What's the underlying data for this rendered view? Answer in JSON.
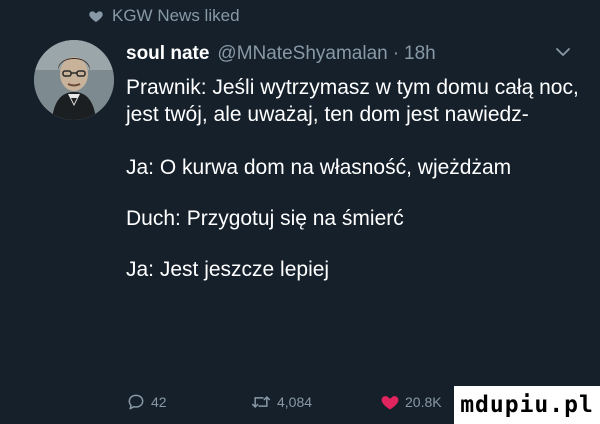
{
  "context": {
    "text": "KGW News liked",
    "icon": "heart-icon"
  },
  "author": {
    "display_name": "soul nate",
    "handle": "@MNateShyamalan",
    "separator": "·",
    "time": "18h"
  },
  "tweet": {
    "paragraphs": [
      "Prawnik: Jeśli wytrzymasz w tym domu całą noc, jest twój, ale uważaj, ten dom jest nawiedz-",
      "Ja: O kurwa dom na własność, wjeżdżam",
      "Duch: Przygotuj się na śmierć",
      "Ja: Jest jeszcze lepiej"
    ]
  },
  "actions": {
    "reply_count": "42",
    "retweet_count": "4,084",
    "like_count": "20.8K"
  },
  "watermark": {
    "text": "mdupiu.pl"
  },
  "colors": {
    "background": "#15202b",
    "text": "#ffffff",
    "secondary": "#8899a6",
    "like": "#e0245e"
  }
}
